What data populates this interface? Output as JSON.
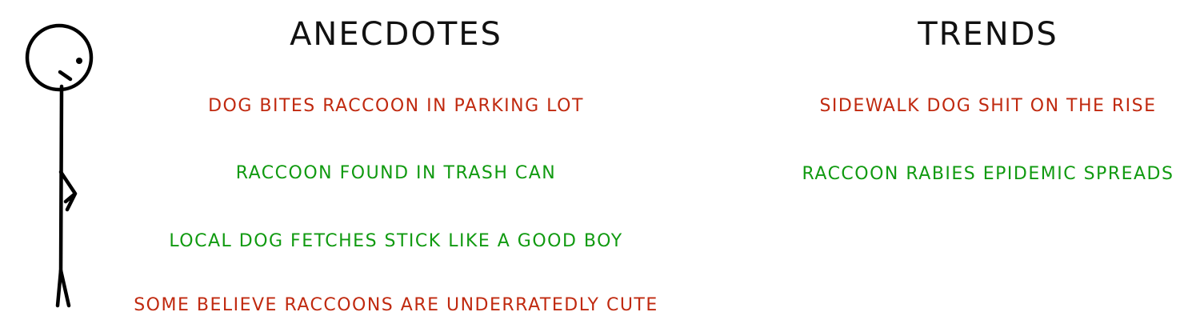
{
  "colors": {
    "negative": "#c0290f",
    "positive": "#109a10",
    "ink": "#111111"
  },
  "anecdotes": {
    "title": "ANECDOTES",
    "items": [
      {
        "text": "DOG BITES RACCOON IN PARKING LOT",
        "color": "red"
      },
      {
        "text": "RACCOON FOUND IN TRASH CAN",
        "color": "green"
      },
      {
        "text": "LOCAL DOG FETCHES STICK LIKE A GOOD BOY",
        "color": "green"
      },
      {
        "text": "SOME BELIEVE RACCOONS ARE UNDERRATEDLY CUTE",
        "color": "red"
      }
    ]
  },
  "trends": {
    "title": "TRENDS",
    "items": [
      {
        "text": "SIDEWALK DOG SHIT ON THE RISE",
        "color": "red"
      },
      {
        "text": "RACCOON RABIES EPIDEMIC SPREADS",
        "color": "green"
      }
    ]
  }
}
